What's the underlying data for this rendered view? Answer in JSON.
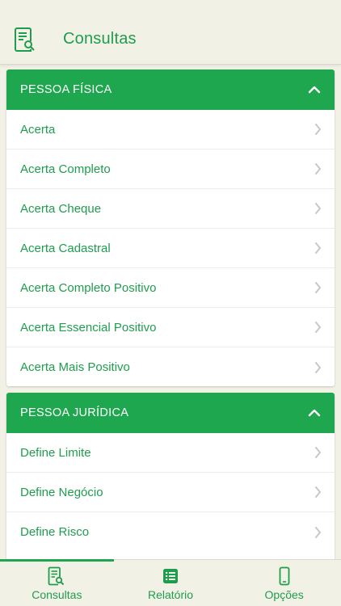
{
  "header": {
    "title": "Consultas",
    "icon": "document-search-icon"
  },
  "sections": [
    {
      "label": "PESSOA FÍSICA",
      "expanded": true,
      "items": [
        "Acerta",
        "Acerta Completo",
        "Acerta Cheque",
        "Acerta Cadastral",
        "Acerta Completo Positivo",
        "Acerta Essencial Positivo",
        "Acerta Mais Positivo"
      ]
    },
    {
      "label": "PESSOA JURÍDICA",
      "expanded": true,
      "items": [
        "Define Limite",
        "Define Negócio",
        "Define Risco"
      ]
    }
  ],
  "tabbar": {
    "tabs": [
      {
        "label": "Consultas",
        "icon": "document-search-icon",
        "active": true
      },
      {
        "label": "Relatório",
        "icon": "list-icon",
        "active": false
      },
      {
        "label": "Opções",
        "icon": "phone-icon",
        "active": false
      }
    ]
  },
  "colors": {
    "accent": "#1ea74e",
    "text_green": "#1f9d4e",
    "background": "#f2f1e6"
  }
}
